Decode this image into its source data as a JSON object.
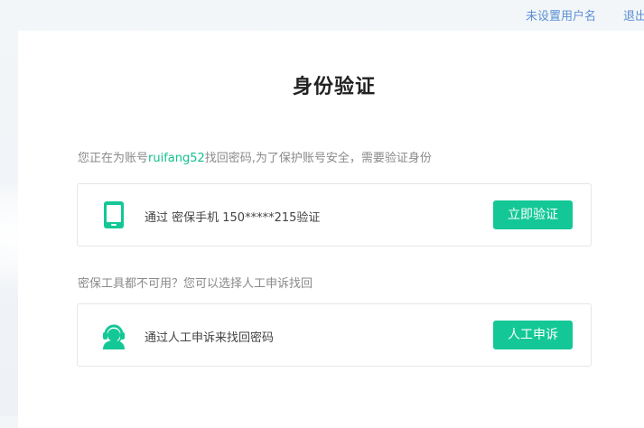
{
  "topbar": {
    "username_link": "未设置用户名",
    "exit_link": "退出"
  },
  "main": {
    "title": "身份验证",
    "intro_prefix": "您正在为账号",
    "account": "ruifang52",
    "intro_suffix": "找回密码,为了保护账号安全，需要验证身份",
    "fallback_text": "密保工具都不可用？您可以选择人工申诉找回"
  },
  "options": {
    "phone": {
      "label": "通过 密保手机 150*****215验证",
      "button": "立即验证",
      "icon": "mobile-phone-icon"
    },
    "appeal": {
      "label": "通过人工申诉来找回密码",
      "button": "人工申诉",
      "icon": "customer-service-icon"
    }
  },
  "colors": {
    "accent": "#13c896",
    "link": "#5a8fd3",
    "account_text": "#13c18f"
  }
}
